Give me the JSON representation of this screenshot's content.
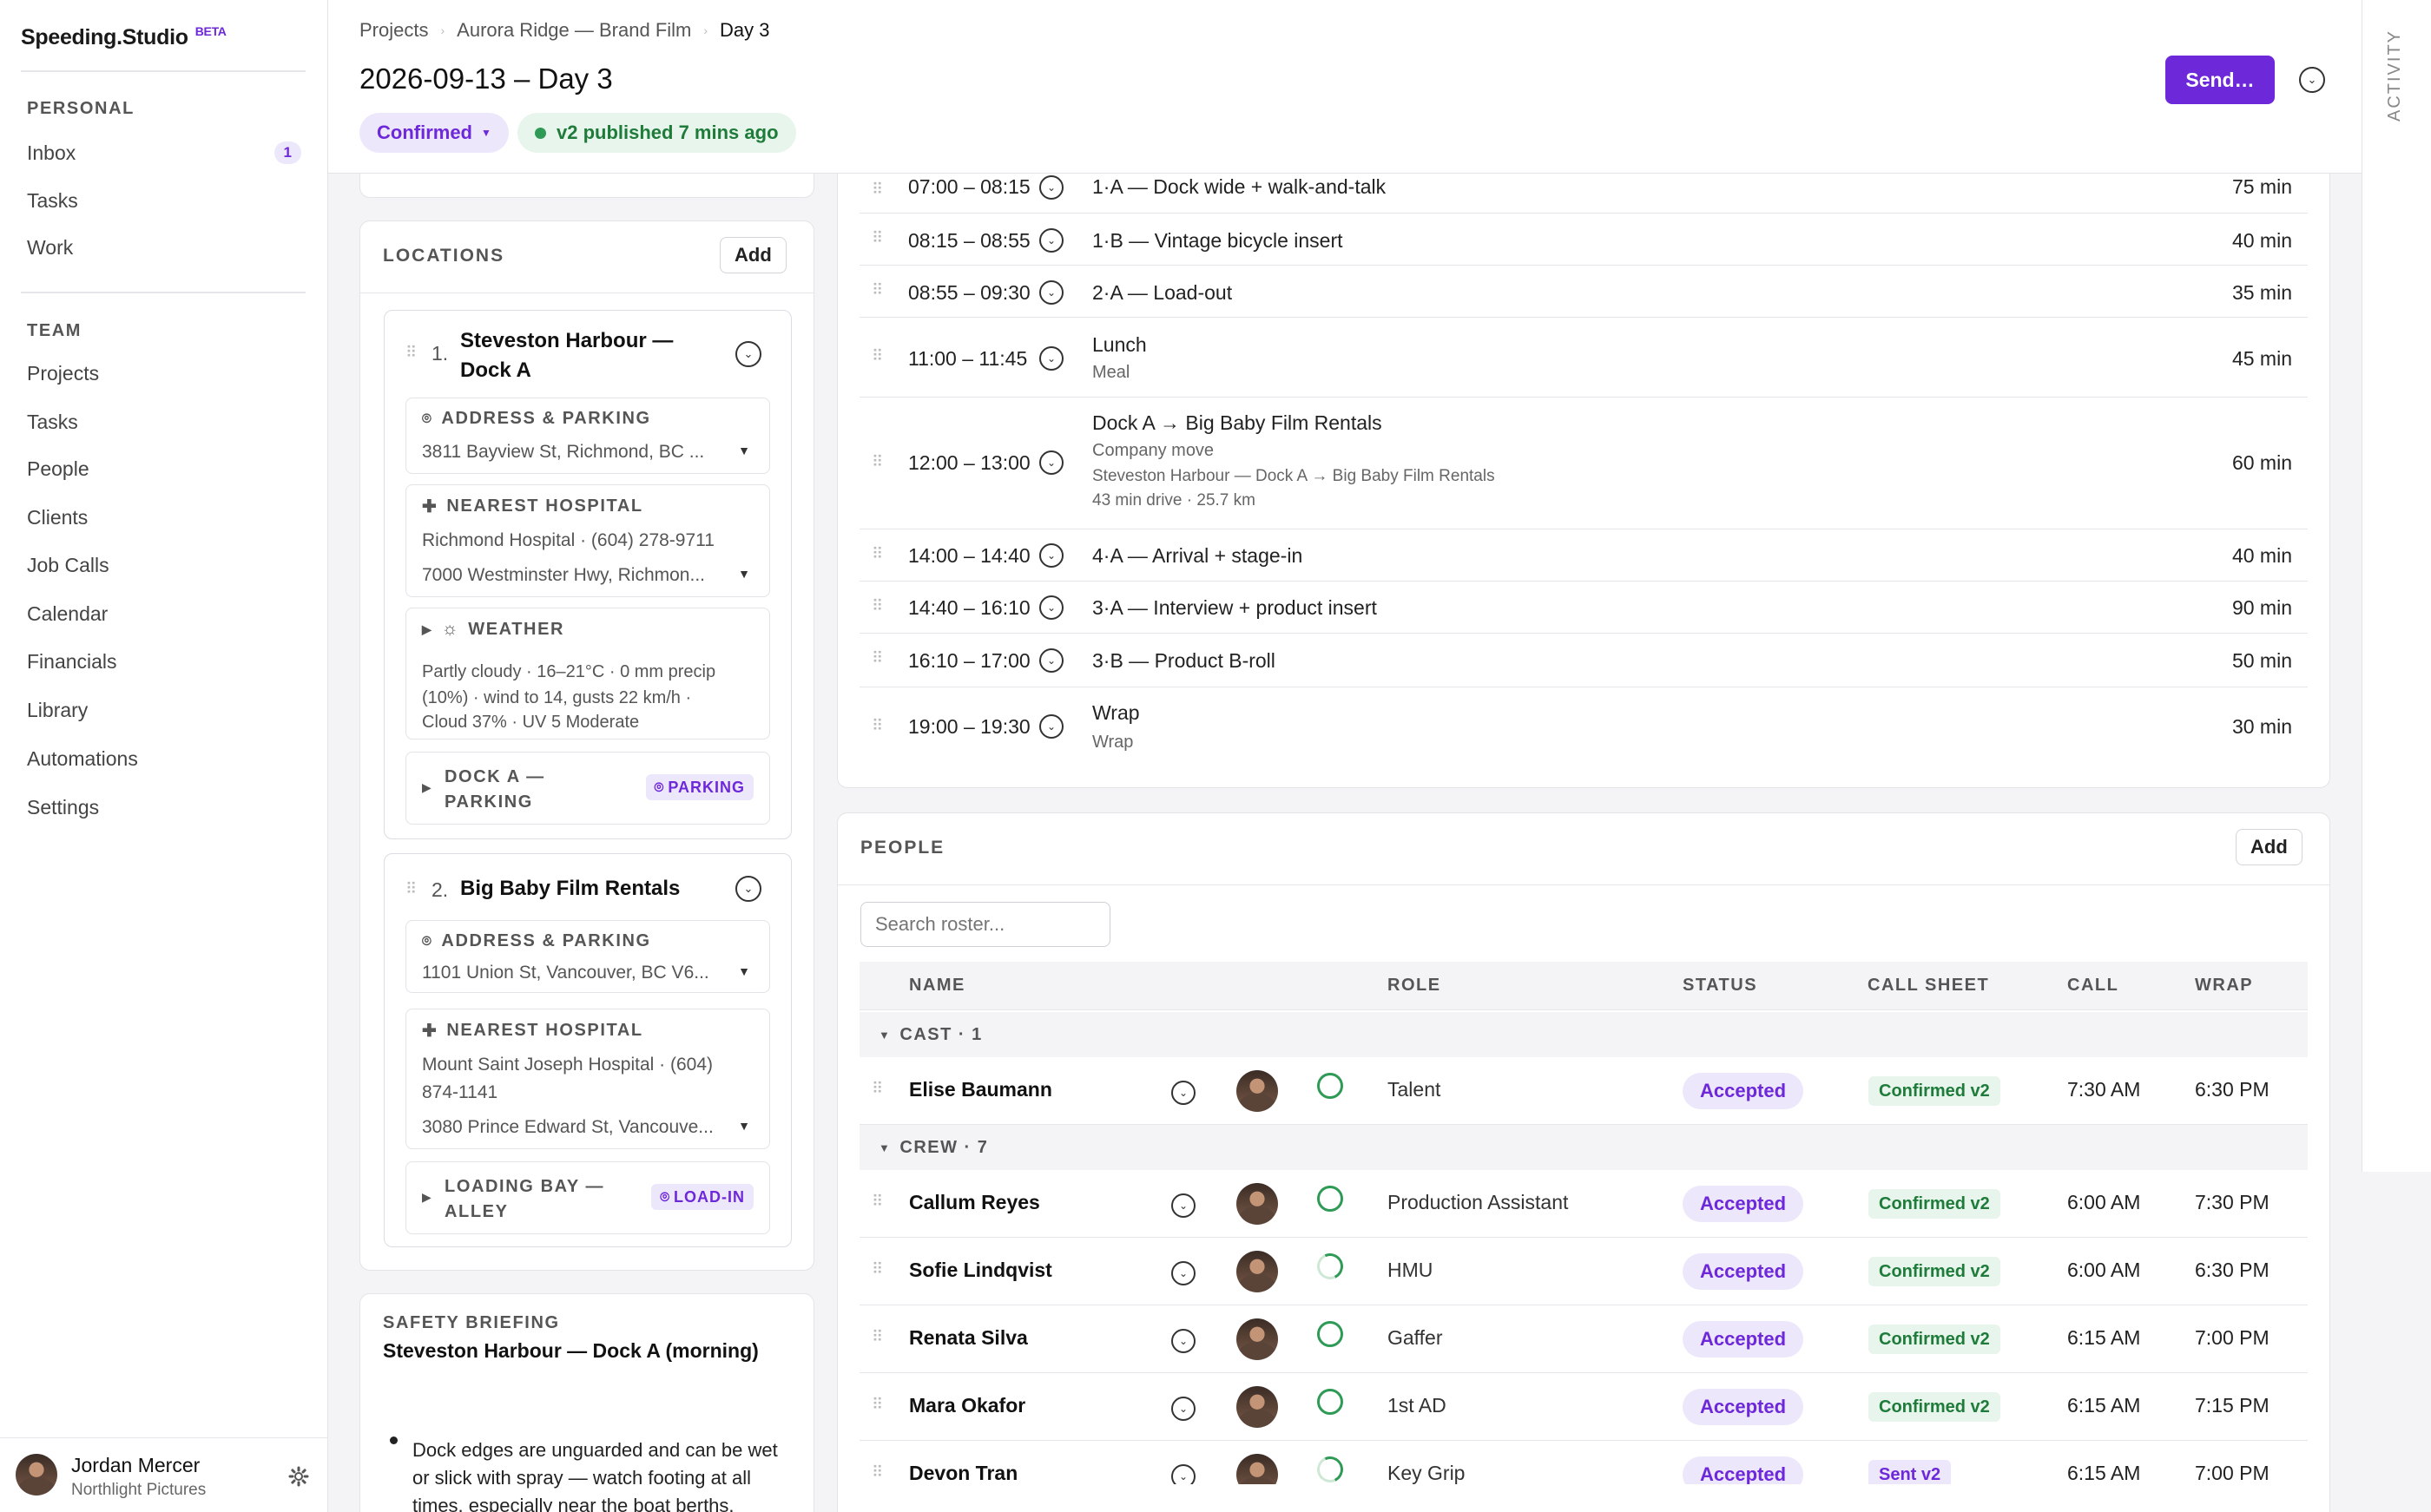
{
  "app": {
    "name": "Speeding.Studio",
    "badge": "BETA"
  },
  "sidebar": {
    "personal_label": "PERSONAL",
    "personal": [
      {
        "label": "Inbox",
        "count": "1"
      },
      {
        "label": "Tasks"
      },
      {
        "label": "Work"
      }
    ],
    "team_label": "TEAM",
    "team": [
      {
        "label": "Projects"
      },
      {
        "label": "Tasks"
      },
      {
        "label": "People"
      },
      {
        "label": "Clients"
      },
      {
        "label": "Job Calls"
      },
      {
        "label": "Calendar"
      },
      {
        "label": "Financials"
      },
      {
        "label": "Library"
      },
      {
        "label": "Automations"
      },
      {
        "label": "Settings"
      }
    ],
    "user": {
      "name": "Jordan Mercer",
      "org": "Northlight Pictures"
    }
  },
  "header": {
    "breadcrumbs": [
      "Projects",
      "Aurora Ridge — Brand Film",
      "Day 3"
    ],
    "title": "2026-09-13 – Day 3",
    "status": "Confirmed",
    "published": "v2 published 7 mins ago",
    "send_label": "Send…",
    "activity_label": "ACTIVITY"
  },
  "locations": {
    "title": "LOCATIONS",
    "add_label": "Add",
    "items": [
      {
        "index": "1.",
        "name_line1": "Steveston Harbour —",
        "name_line2": "Dock A",
        "address_label": "ADDRESS & PARKING",
        "address": "3811 Bayview St, Richmond, BC ...",
        "hospital_label": "NEAREST HOSPITAL",
        "hospital_line1": "Richmond Hospital · (604) 278-9711",
        "hospital_line2": "7000 Westminster Hwy, Richmon...",
        "weather_label": "WEATHER",
        "weather_line1": "Partly cloudy · 16–21°C · 0 mm precip",
        "weather_line2": "(10%) · wind to 14, gusts 22 km/h ·",
        "weather_line3": "Cloud 37% · UV 5 Moderate",
        "sub_line1": "DOCK A —",
        "sub_line2": "PARKING",
        "sub_tag": "PARKING"
      },
      {
        "index": "2.",
        "name_line1": "Big Baby Film Rentals",
        "address_label": "ADDRESS & PARKING",
        "address": "1101 Union St, Vancouver, BC V6...",
        "hospital_label": "NEAREST HOSPITAL",
        "hospital_line1": "Mount Saint Joseph Hospital · (604)",
        "hospital_line1b": "874-1141",
        "hospital_line2": "3080 Prince Edward St, Vancouve...",
        "sub_line1": "LOADING BAY —",
        "sub_line2": "ALLEY",
        "sub_tag": "LOAD-IN"
      }
    ]
  },
  "safety": {
    "label": "SAFETY BRIEFING",
    "title": "Steveston Harbour — Dock A (morning)",
    "bullet_line1": "Dock edges are unguarded and can be wet",
    "bullet_line2": "or slick with spray — watch footing at all",
    "bullet_line3": "times, especially near the boat berths."
  },
  "schedule": [
    {
      "time": "07:00 – 08:15",
      "title": "1·A — Dock wide + walk-and-talk",
      "dur": "75 min"
    },
    {
      "time": "08:15 – 08:55",
      "title": "1·B — Vintage bicycle insert",
      "dur": "40 min"
    },
    {
      "time": "08:55 – 09:30",
      "title": "2·A — Load-out",
      "dur": "35 min"
    },
    {
      "time": "11:00 – 11:45",
      "title": "Lunch",
      "sub": "Meal",
      "dur": "45 min"
    },
    {
      "time": "12:00 – 13:00",
      "title": "Dock A → Big Baby Film Rentals",
      "sub": "Company move",
      "sub2": "Steveston Harbour — Dock A → Big Baby Film Rentals",
      "sub3": "43 min drive · 25.7 km",
      "dur": "60 min"
    },
    {
      "time": "14:00 – 14:40",
      "title": "4·A — Arrival + stage-in",
      "dur": "40 min"
    },
    {
      "time": "14:40 – 16:10",
      "title": "3·A — Interview + product insert",
      "dur": "90 min"
    },
    {
      "time": "16:10 – 17:00",
      "title": "3·B — Product B-roll",
      "dur": "50 min"
    },
    {
      "time": "19:00 – 19:30",
      "title": "Wrap",
      "sub": "Wrap",
      "dur": "30 min"
    }
  ],
  "people": {
    "title": "PEOPLE",
    "add_label": "Add",
    "search_placeholder": "Search roster...",
    "columns": {
      "name": "NAME",
      "role": "ROLE",
      "status": "STATUS",
      "call_sheet": "CALL SHEET",
      "call": "CALL",
      "wrap": "WRAP"
    },
    "cast_label": "CAST · 1",
    "crew_label": "CREW · 7",
    "cast": [
      {
        "name": "Elise Baumann",
        "role": "Talent",
        "status": "Accepted",
        "sheet": "Confirmed v2",
        "call": "7:30 AM",
        "wrap": "6:30 PM"
      }
    ],
    "crew": [
      {
        "name": "Callum Reyes",
        "role": "Production Assistant",
        "status": "Accepted",
        "sheet": "Confirmed v2",
        "call": "6:00 AM",
        "wrap": "7:30 PM"
      },
      {
        "name": "Sofie Lindqvist",
        "role": "HMU",
        "status": "Accepted",
        "sheet": "Confirmed v2",
        "call": "6:00 AM",
        "wrap": "6:30 PM"
      },
      {
        "name": "Renata Silva",
        "role": "Gaffer",
        "status": "Accepted",
        "sheet": "Confirmed v2",
        "call": "6:15 AM",
        "wrap": "7:00 PM"
      },
      {
        "name": "Mara Okafor",
        "role": "1st AD",
        "status": "Accepted",
        "sheet": "Confirmed v2",
        "call": "6:15 AM",
        "wrap": "7:15 PM"
      },
      {
        "name": "Devon Tran",
        "role": "Key Grip",
        "status": "Accepted",
        "sheet": "Sent v2",
        "call": "6:15 AM",
        "wrap": "7:00 PM"
      }
    ]
  },
  "colors": {
    "accent": "#6d28d9",
    "success": "#1e7b3a"
  }
}
